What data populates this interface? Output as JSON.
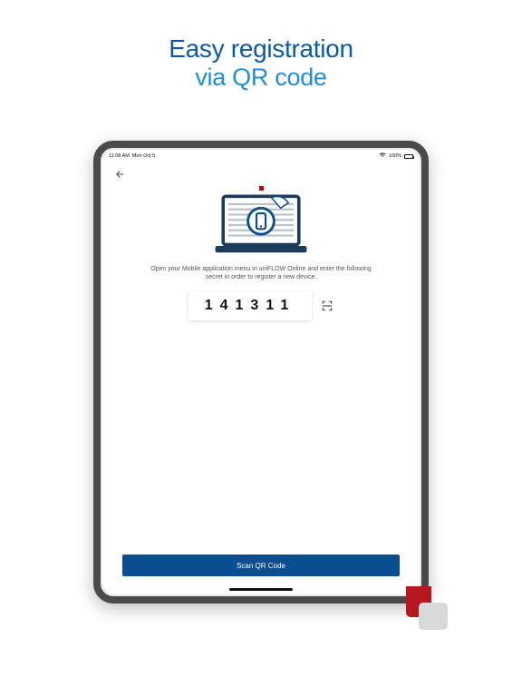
{
  "promo": {
    "line1": "Easy registration",
    "line2": "via QR code"
  },
  "status_bar": {
    "time": "11:08 AM",
    "date": "Mon Oct 5",
    "battery_text": "100%",
    "wifi_icon": "wifi"
  },
  "screen": {
    "instruction": "Open your Mobile application menu in uniFLOW Online and enter the following secret in order to register a new device.",
    "registration_code": "141311",
    "scan_button_label": "Scan QR Code"
  },
  "icons": {
    "back": "arrow-left",
    "qr_scan": "qr-scan-frame",
    "laptop_phone": "laptop-with-phone"
  },
  "colors": {
    "primary_dark": "#0a4e90",
    "title_dark": "#0a5aa8",
    "title_light": "#1f8fd8",
    "accent_red": "#b5171c"
  }
}
